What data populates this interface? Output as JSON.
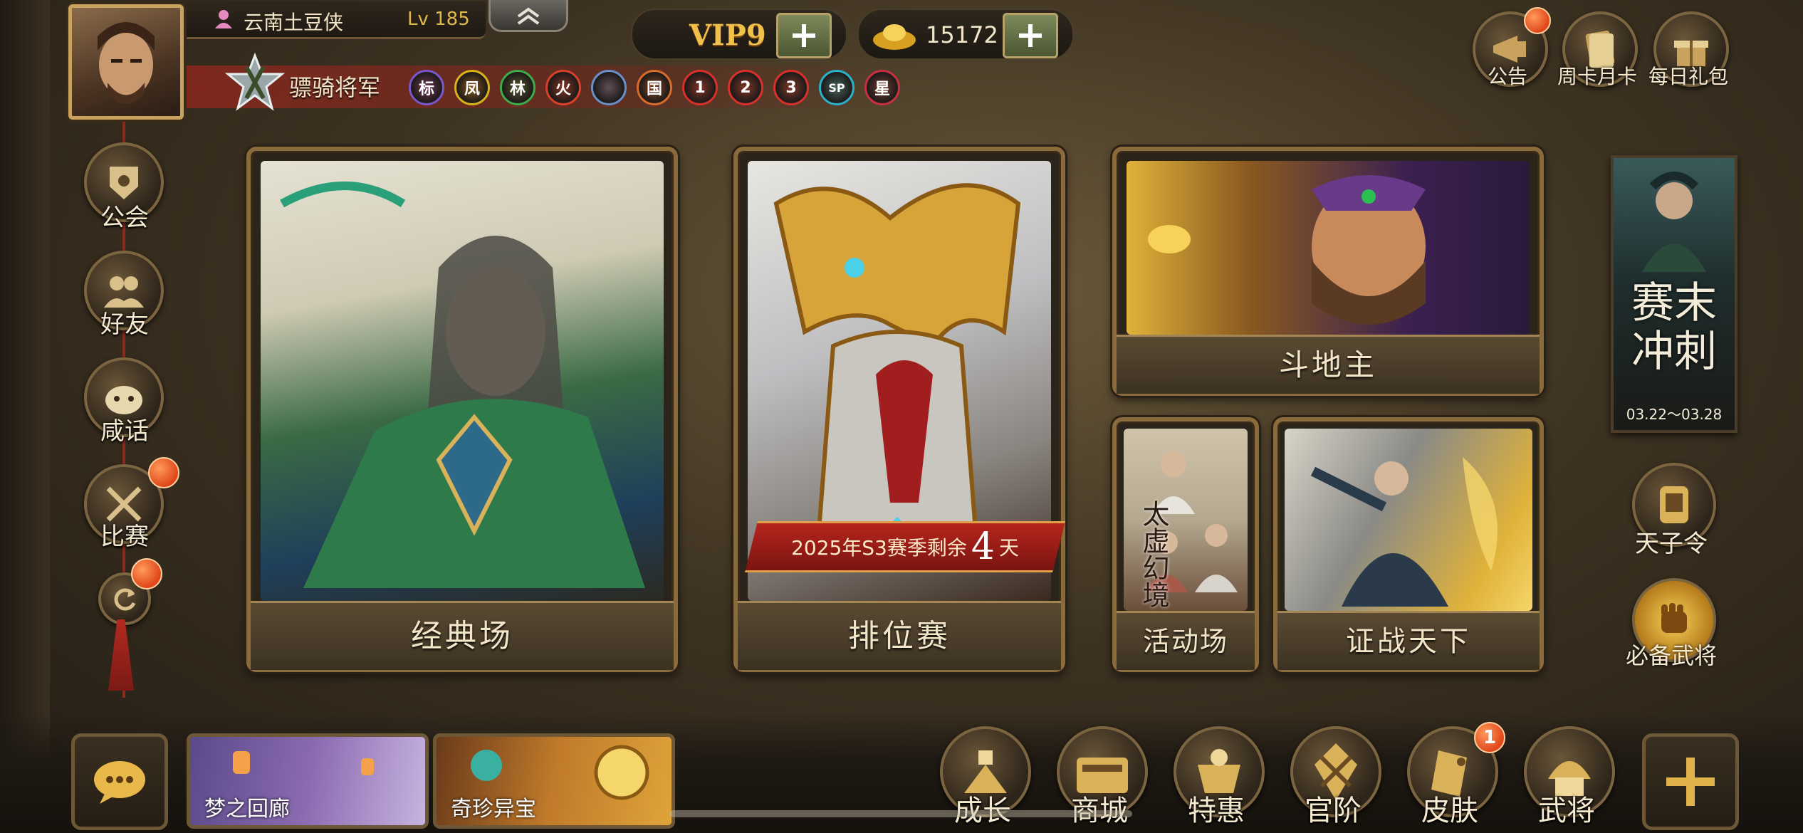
{
  "player": {
    "name": "云南土豆侠",
    "level": "Lv 185",
    "rank_title": "骠骑将军"
  },
  "currency": {
    "vip": "VIP9",
    "gold": "15172"
  },
  "badges": [
    {
      "label": "标",
      "color": "#7a56c8"
    },
    {
      "label": "凤",
      "color": "#d9b21a"
    },
    {
      "label": "林",
      "color": "#3faa4a"
    },
    {
      "label": "火",
      "color": "#d8402a"
    },
    {
      "label": "",
      "color": "#6a8ec8"
    },
    {
      "label": "国",
      "color": "#d86a2a"
    },
    {
      "label": "1",
      "color": "#d8302a"
    },
    {
      "label": "2",
      "color": "#d8302a"
    },
    {
      "label": "3",
      "color": "#d8302a"
    },
    {
      "label": "SP",
      "color": "#2ab0c8"
    },
    {
      "label": "星",
      "color": "#c83040"
    }
  ],
  "top_right": [
    {
      "label": "公告",
      "icon": "announcement-icon"
    },
    {
      "label": "周卡月卡",
      "icon": "card-icon"
    },
    {
      "label": "每日礼包",
      "icon": "gift-icon"
    }
  ],
  "left_menu": [
    {
      "label": "公会",
      "icon": "guild-icon"
    },
    {
      "label": "好友",
      "icon": "friends-icon"
    },
    {
      "label": "咸话",
      "icon": "chat-bun-icon"
    },
    {
      "label": "比赛",
      "icon": "crossed-swords-icon"
    }
  ],
  "modes": {
    "classic": "经典场",
    "ranked": "排位赛",
    "season_prefix": "2025年S3赛季剩余",
    "season_days": "4",
    "season_suffix": "天",
    "landlord": "斗地主",
    "event": "活动场",
    "event_art_text": "太虚幻境",
    "conquest": "证战天下"
  },
  "right_side": {
    "banner_title": "赛末冲刺",
    "banner_dates": "03.22～03.28",
    "tianzi": "天子令",
    "must_general": "必备武将"
  },
  "bottom_left": {
    "dream": "梦之回廊",
    "treasure": "奇珍异宝"
  },
  "bottom_nav": [
    {
      "label": "成长",
      "icon": "growth-icon"
    },
    {
      "label": "商城",
      "icon": "shop-icon"
    },
    {
      "label": "特惠",
      "icon": "deal-icon"
    },
    {
      "label": "官阶",
      "icon": "rank-icon"
    },
    {
      "label": "皮肤",
      "icon": "skin-icon",
      "badge": "1"
    },
    {
      "label": "武将",
      "icon": "general-icon"
    }
  ],
  "colors": {
    "notify": "#e0461a",
    "frame": "#8a6b3c"
  }
}
